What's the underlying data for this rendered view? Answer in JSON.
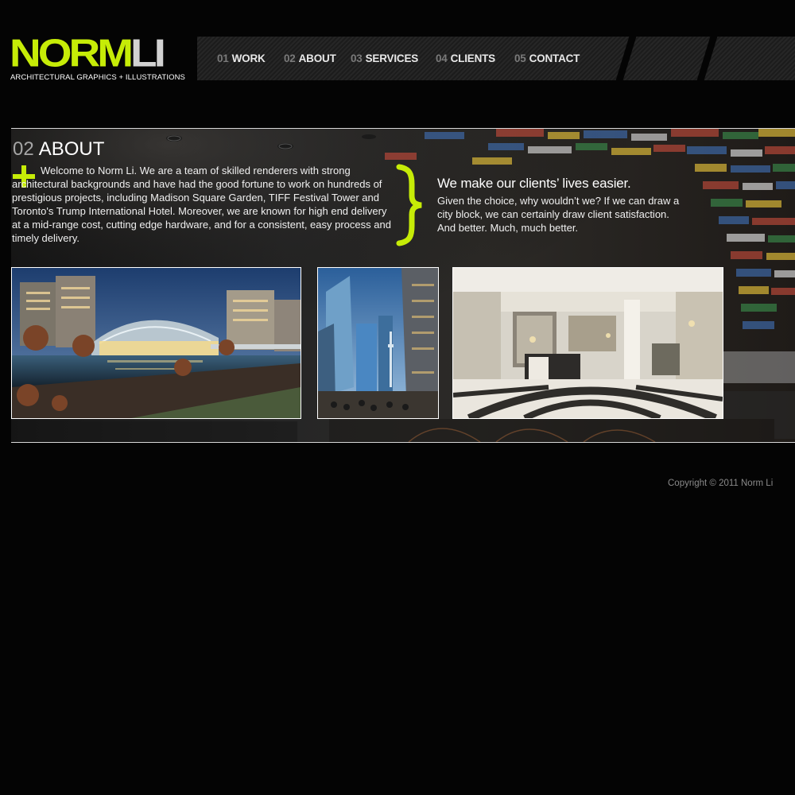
{
  "logo": {
    "word_norm": "NORM",
    "word_li": "LI",
    "tagline": "ARCHITECTURAL GRAPHICS + ILLUSTRATIONS"
  },
  "nav": {
    "items": [
      {
        "num": "01",
        "label": "WORK"
      },
      {
        "num": "02",
        "label": "ABOUT"
      },
      {
        "num": "03",
        "label": "SERVICES"
      },
      {
        "num": "04",
        "label": "CLIENTS"
      },
      {
        "num": "05",
        "label": "CONTACT"
      }
    ]
  },
  "about": {
    "num": "02",
    "title": "ABOUT",
    "intro": "Welcome to Norm Li. We are a team of skilled renderers with strong architectural backgrounds and have had the good fortune to work on hundreds of prestigious projects, including Madison Square Garden, TIFF Festival Tower and Toronto's Trump International Hotel. Moreover, we are known for high end delivery at a mid-range cost, cutting edge hardware, and for a consistent, easy process and timely delivery.",
    "tagline_heading": "We make our clients’ lives easier.",
    "tagline_body": "Given the choice, why wouldn’t we? If we can draw a city block, we can certainly draw client satisfaction. And better. Much, much better."
  },
  "footer": {
    "copyright": "Copyright © 2011 Norm Li"
  },
  "colors": {
    "accent": "#c6ec07",
    "background": "#040404",
    "text": "#ffffff",
    "muted": "#8a8a8a"
  }
}
